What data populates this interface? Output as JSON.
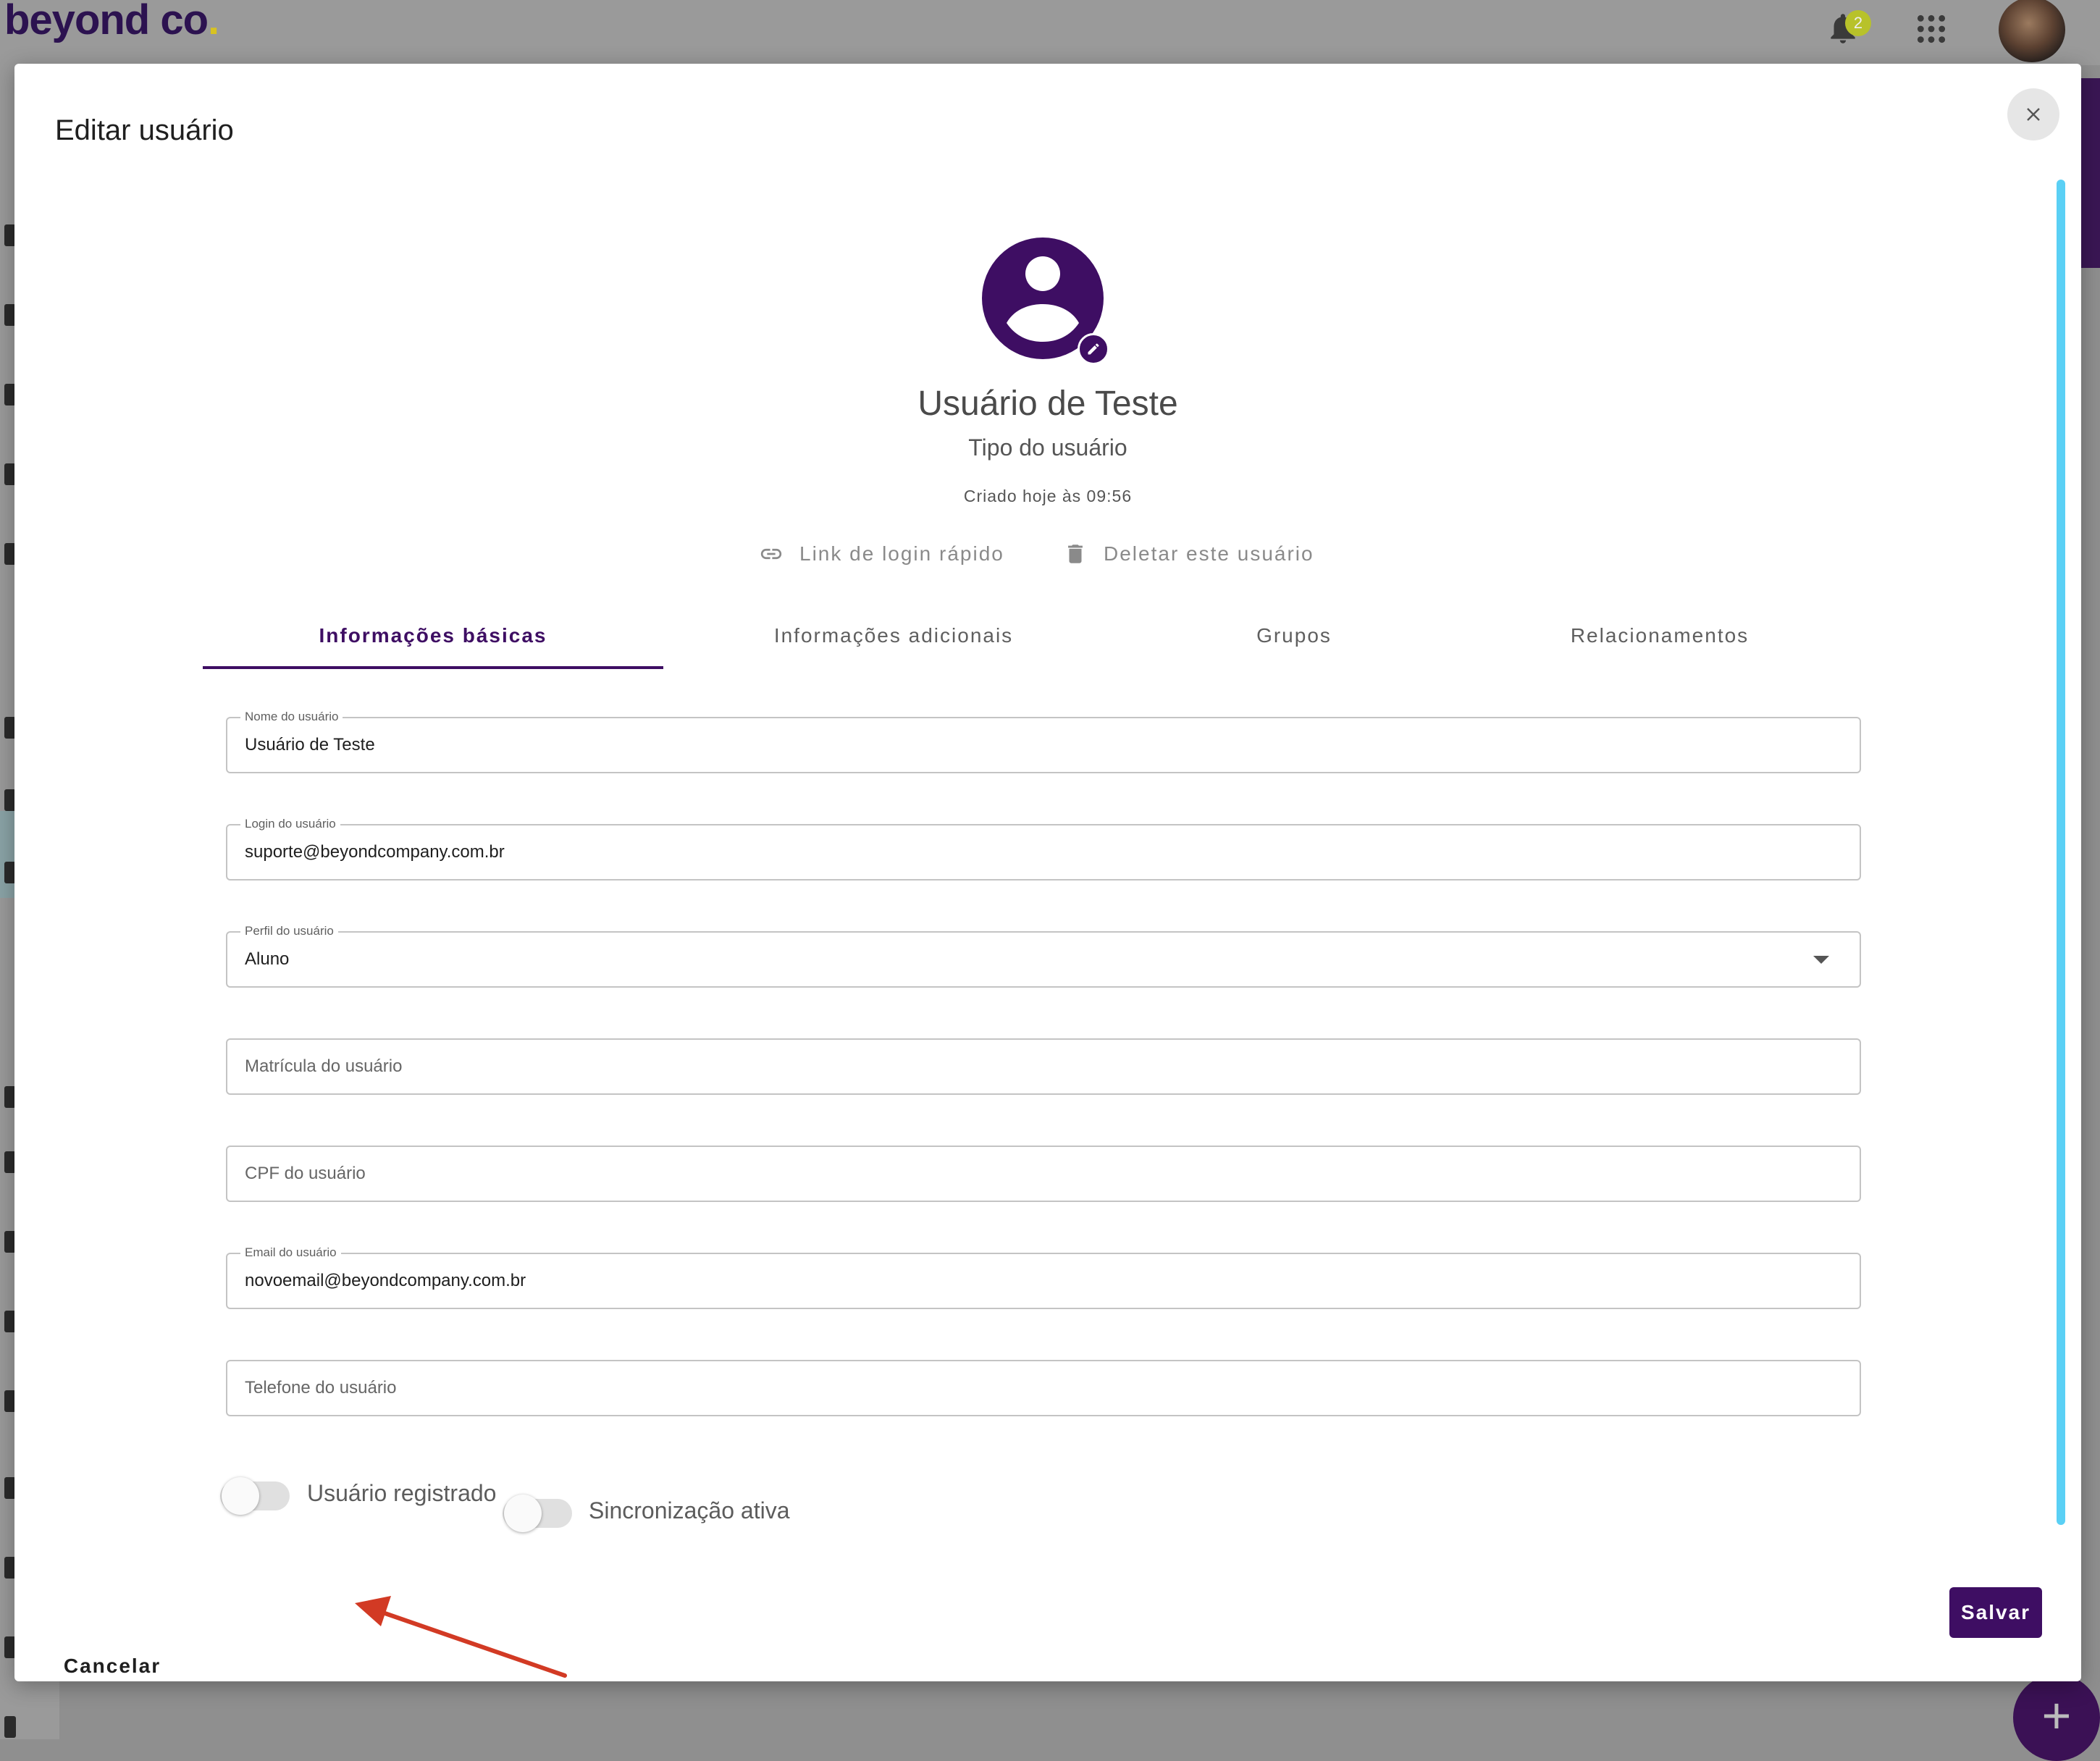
{
  "app": {
    "brand_text": "beyond co",
    "brand_dot": ".",
    "notification_count": "2",
    "colors": {
      "primary": "#3e0e63",
      "scrollbar": "#5ad0f5",
      "annotation_arrow": "#d23a24"
    }
  },
  "dialog": {
    "title": "Editar usuário",
    "profile": {
      "name": "Usuário de Teste",
      "type": "Tipo do usuário",
      "created": "Criado hoje às 09:56"
    },
    "actions": {
      "quick_login": "Link de login rápido",
      "delete_user": "Deletar este usuário"
    },
    "tabs": [
      {
        "label": "Informações básicas",
        "active": true
      },
      {
        "label": "Informações adicionais",
        "active": false
      },
      {
        "label": "Grupos",
        "active": false
      },
      {
        "label": "Relacionamentos",
        "active": false
      }
    ],
    "fields": {
      "name": {
        "label": "Nome do usuário",
        "value": "Usuário de Teste"
      },
      "login": {
        "label": "Login do usuário",
        "value": "suporte@beyondcompany.com.br"
      },
      "profile": {
        "label": "Perfil do usuário",
        "value": "Aluno"
      },
      "registration": {
        "placeholder": "Matrícula do usuário"
      },
      "cpf": {
        "placeholder": "CPF do usuário"
      },
      "email": {
        "label": "Email do usuário",
        "value": "novoemail@beyondcompany.com.br"
      },
      "phone": {
        "placeholder": "Telefone do usuário"
      }
    },
    "toggles": {
      "registered": {
        "label": "Usuário registrado",
        "on": false
      },
      "sync": {
        "label": "Sincronização ativa",
        "on": false
      }
    },
    "buttons": {
      "cancel": "Cancelar",
      "save": "Salvar"
    }
  }
}
